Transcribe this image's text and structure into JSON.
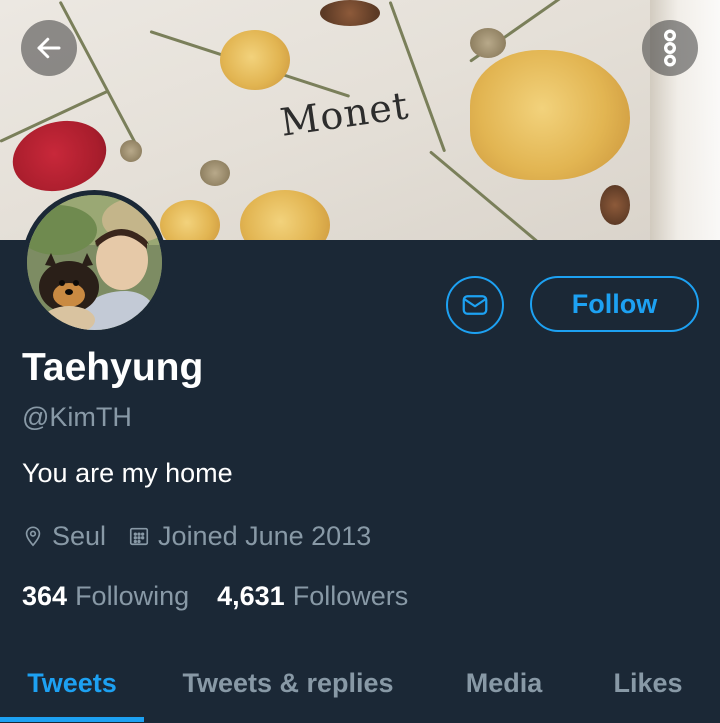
{
  "banner": {
    "word": "Monet"
  },
  "header": {
    "back_icon": "arrow-left-icon",
    "more_icon": "more-vertical-icon"
  },
  "profile": {
    "name": "Taehyung",
    "handle": "@KimTH",
    "bio": "You are my home",
    "location": "Seul",
    "joined": "Joined June 2013",
    "following_count": "364",
    "following_label": "Following",
    "followers_count": "4,631",
    "followers_label": "Followers"
  },
  "actions": {
    "message_icon": "envelope-icon",
    "follow_label": "Follow"
  },
  "tabs": [
    {
      "label": "Tweets",
      "active": true
    },
    {
      "label": "Tweets & replies",
      "active": false
    },
    {
      "label": "Media",
      "active": false
    },
    {
      "label": "Likes",
      "active": false
    }
  ],
  "colors": {
    "accent": "#1da1f2",
    "background": "#1b2836",
    "secondary_text": "#8899a6"
  }
}
